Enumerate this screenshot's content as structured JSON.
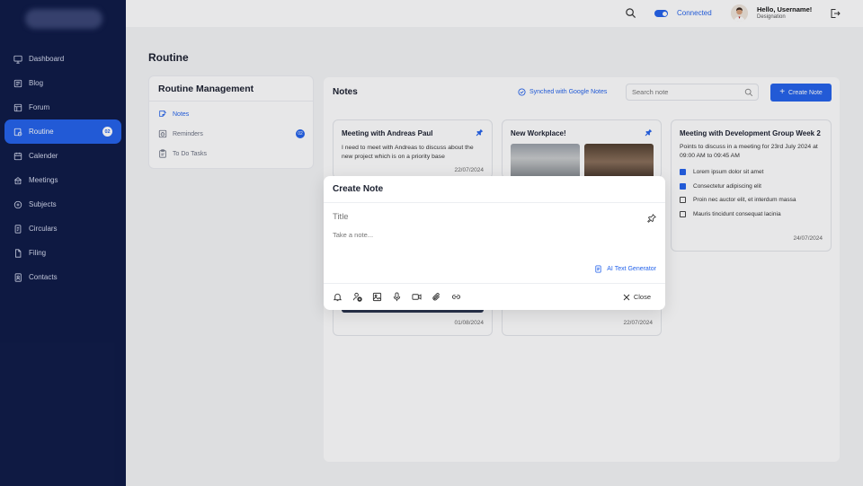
{
  "sidebar": {
    "items": [
      {
        "label": "Dashboard",
        "icon": "monitor-icon"
      },
      {
        "label": "Blog",
        "icon": "blog-icon"
      },
      {
        "label": "Forum",
        "icon": "forum-icon"
      },
      {
        "label": "Routine",
        "icon": "routine-icon",
        "badge": "02",
        "active": true
      },
      {
        "label": "Calender",
        "icon": "calendar-icon"
      },
      {
        "label": "Meetings",
        "icon": "meetings-icon"
      },
      {
        "label": "Subjects",
        "icon": "subjects-icon"
      },
      {
        "label": "Circulars",
        "icon": "circulars-icon"
      },
      {
        "label": "Filing",
        "icon": "file-icon"
      },
      {
        "label": "Contacts",
        "icon": "contacts-icon"
      }
    ]
  },
  "topbar": {
    "connection_label": "Connected",
    "connected": true,
    "greeting": "Hello, Username!",
    "designation": "Designation"
  },
  "page": {
    "title": "Routine"
  },
  "routine_management": {
    "title": "Routine Management",
    "items": [
      {
        "label": "Notes",
        "active": true
      },
      {
        "label": "Reminders",
        "badge": "02"
      },
      {
        "label": "To Do Tasks"
      }
    ]
  },
  "notes": {
    "title": "Notes",
    "synced_label": "Synched with Google Notes",
    "search_placeholder": "Search note",
    "create_label": "Create Note",
    "cards": [
      {
        "title": "Meeting with Andreas Paul",
        "body": "I need to meet with Andreas to discuss about the new project which is on a priority base",
        "date": "22/07/2024",
        "pinned": true
      },
      {
        "title": "New Workplace!",
        "pinned": true
      },
      {
        "title": "Meeting with Development Group Week 2",
        "body": "Points to discuss in a meeting for 23rd July 2024 at 09:00 AM to 09:45 AM",
        "checklist": [
          {
            "text": "Lorem ipsum dolor sit amet",
            "checked": true
          },
          {
            "text": "Consectetur adipiscing elit",
            "checked": true
          },
          {
            "text": "Proin nec auctor elit, et interdum massa",
            "checked": false
          },
          {
            "text": "Mauris tincidunt consequat lacinia",
            "checked": false
          }
        ],
        "date": "24/07/2024"
      }
    ],
    "lower_dates": [
      "01/08/2024",
      "22/07/2024"
    ]
  },
  "modal": {
    "title": "Create Note",
    "title_placeholder": "Title",
    "note_placeholder": "Take a note...",
    "ai_label": "AI Text Generator",
    "toolbar_icons": [
      "bell-icon",
      "add-collaborator-icon",
      "image-icon",
      "microphone-icon",
      "video-icon",
      "attachment-icon",
      "link-icon"
    ],
    "close_label": "Close"
  },
  "colors": {
    "sidebar_bg": "#0e1a47",
    "accent": "#2463eb",
    "page_bg": "#f4f5f7"
  }
}
